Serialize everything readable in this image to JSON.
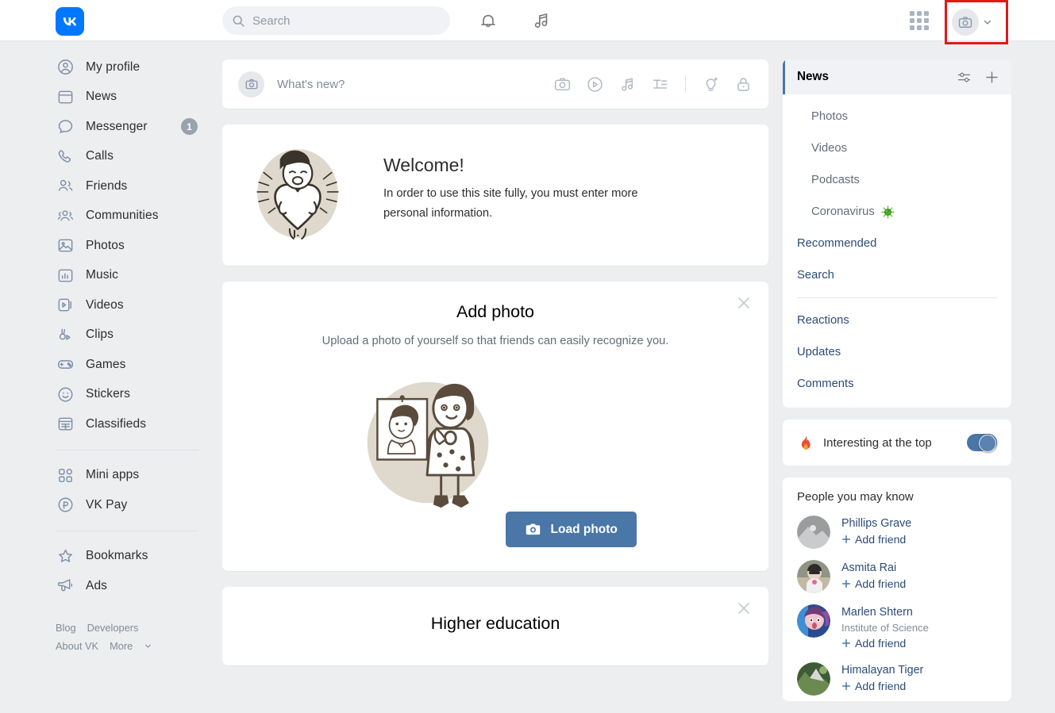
{
  "header": {
    "logo_icon": "vk-logo-icon",
    "search": {
      "placeholder": "Search",
      "value": ""
    },
    "bell_icon": "bell-icon",
    "music_icon": "music-note-icon",
    "apps_icon": "apps-grid-icon",
    "avatar_icon": "camera-avatar-icon",
    "chevron_icon": "chevron-down-icon"
  },
  "sidebar": {
    "items": [
      {
        "label": "My profile",
        "icon": "user-circle-icon"
      },
      {
        "label": "News",
        "icon": "news-icon"
      },
      {
        "label": "Messenger",
        "icon": "chat-bubble-icon",
        "badge": "1"
      },
      {
        "label": "Calls",
        "icon": "phone-icon"
      },
      {
        "label": "Friends",
        "icon": "friends-icon"
      },
      {
        "label": "Communities",
        "icon": "communities-icon"
      },
      {
        "label": "Photos",
        "icon": "photo-icon"
      },
      {
        "label": "Music",
        "icon": "music-player-icon"
      },
      {
        "label": "Videos",
        "icon": "video-icon"
      },
      {
        "label": "Clips",
        "icon": "clips-icon"
      },
      {
        "label": "Games",
        "icon": "gamepad-icon"
      },
      {
        "label": "Stickers",
        "icon": "smiley-icon"
      },
      {
        "label": "Classifieds",
        "icon": "classifieds-icon"
      }
    ],
    "group2": [
      {
        "label": "Mini apps",
        "icon": "mini-apps-icon"
      },
      {
        "label": "VK Pay",
        "icon": "vk-pay-icon"
      }
    ],
    "group3": [
      {
        "label": "Bookmarks",
        "icon": "star-icon"
      },
      {
        "label": "Ads",
        "icon": "megaphone-icon"
      }
    ],
    "footer_links": [
      "Blog",
      "Developers",
      "About VK",
      "More"
    ]
  },
  "postbar": {
    "placeholder": "What's new?",
    "icons": [
      "camera-icon",
      "video-play-icon",
      "music-note-icon",
      "text-icon",
      "idea-icon",
      "lock-icon"
    ]
  },
  "welcome": {
    "title": "Welcome!",
    "body": "In order to use this site fully, you must enter more personal information."
  },
  "add_photo": {
    "title": "Add photo",
    "subtitle": "Upload a photo of yourself so that friends can easily recognize you.",
    "button_label": "Load photo",
    "button_icon": "camera-icon",
    "button_color": "#4a76a8",
    "close_icon": "close-icon"
  },
  "higher_education": {
    "title": "Higher education",
    "close_icon": "close-icon"
  },
  "right_panel": {
    "news_header": {
      "title": "News",
      "filter_icon": "sliders-icon",
      "add_icon": "plus-icon",
      "accent_color": "#4a76a8"
    },
    "news_items": [
      {
        "label": "Photos",
        "sub": true
      },
      {
        "label": "Videos",
        "sub": true
      },
      {
        "label": "Podcasts",
        "sub": true
      },
      {
        "label": "Coronavirus",
        "sub": true,
        "emoji": "virus-icon"
      },
      {
        "label": "Recommended",
        "sub": false
      },
      {
        "label": "Search",
        "sub": false
      }
    ],
    "news_items2": [
      {
        "label": "Reactions"
      },
      {
        "label": "Updates"
      },
      {
        "label": "Comments"
      }
    ],
    "interesting": {
      "label": "Interesting at the top",
      "icon": "fire-icon",
      "toggle_on": true,
      "toggle_color": "#4a76a8"
    },
    "pymk": {
      "title": "People you may know",
      "add_label": "Add friend",
      "add_icon": "plus-icon",
      "people": [
        {
          "name": "Phillips Grave",
          "desc": ""
        },
        {
          "name": "Asmita Rai",
          "desc": ""
        },
        {
          "name": "Marlen Shtern",
          "desc": "Institute of Science"
        },
        {
          "name": "Himalayan Tiger",
          "desc": ""
        }
      ]
    }
  }
}
